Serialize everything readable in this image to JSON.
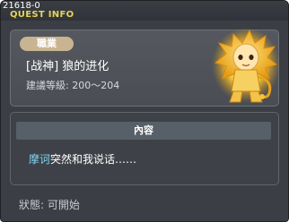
{
  "window": {
    "quest_id": "21618-0",
    "title": "QUEST INFO"
  },
  "quest": {
    "job_badge": "職業",
    "name": "[战神] 狼的进化",
    "level_requirement": "建議等級: 200～204",
    "portrait_icon": "lion-warrior-npc-icon"
  },
  "content": {
    "header": "內容",
    "npc_name": "摩诃",
    "dialogue": "突然和我说话……"
  },
  "status": {
    "text": "狀態:  可開始"
  },
  "colors": {
    "title": "#e6d35a",
    "npc_name": "#7fd6f2",
    "badge": "#c9b491",
    "panel": "#4a4e54"
  }
}
